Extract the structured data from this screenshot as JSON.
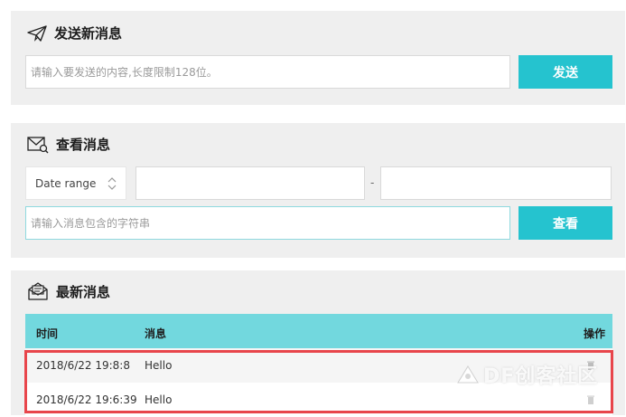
{
  "send": {
    "title": "发送新消息",
    "input_placeholder": "请输入要发送的内容,长度限制128位。",
    "button": "发送"
  },
  "view": {
    "title": "查看消息",
    "date_range_label": "Date range",
    "range_from": "",
    "range_separator": "-",
    "range_to": "",
    "search_placeholder": "请输入消息包含的字符串",
    "button": "查看"
  },
  "latest": {
    "title": "最新消息",
    "columns": {
      "time": "时间",
      "message": "消息",
      "action": "操作"
    },
    "rows": [
      {
        "time": "2018/6/22 19:8:8",
        "message": "Hello"
      },
      {
        "time": "2018/6/22 19:6:39",
        "message": "Hello"
      }
    ]
  },
  "watermark": {
    "text": "DF创客社区"
  },
  "colors": {
    "accent": "#25c3cf",
    "table_header": "#72d8de",
    "panel_bg": "#efefef",
    "highlight": "#e8454b"
  },
  "icons": {
    "send": "paper-plane-icon",
    "view": "envelope-search-icon",
    "latest": "open-envelope-icon",
    "delete": "trash-icon",
    "sort": "up-down-chevron-icon"
  }
}
